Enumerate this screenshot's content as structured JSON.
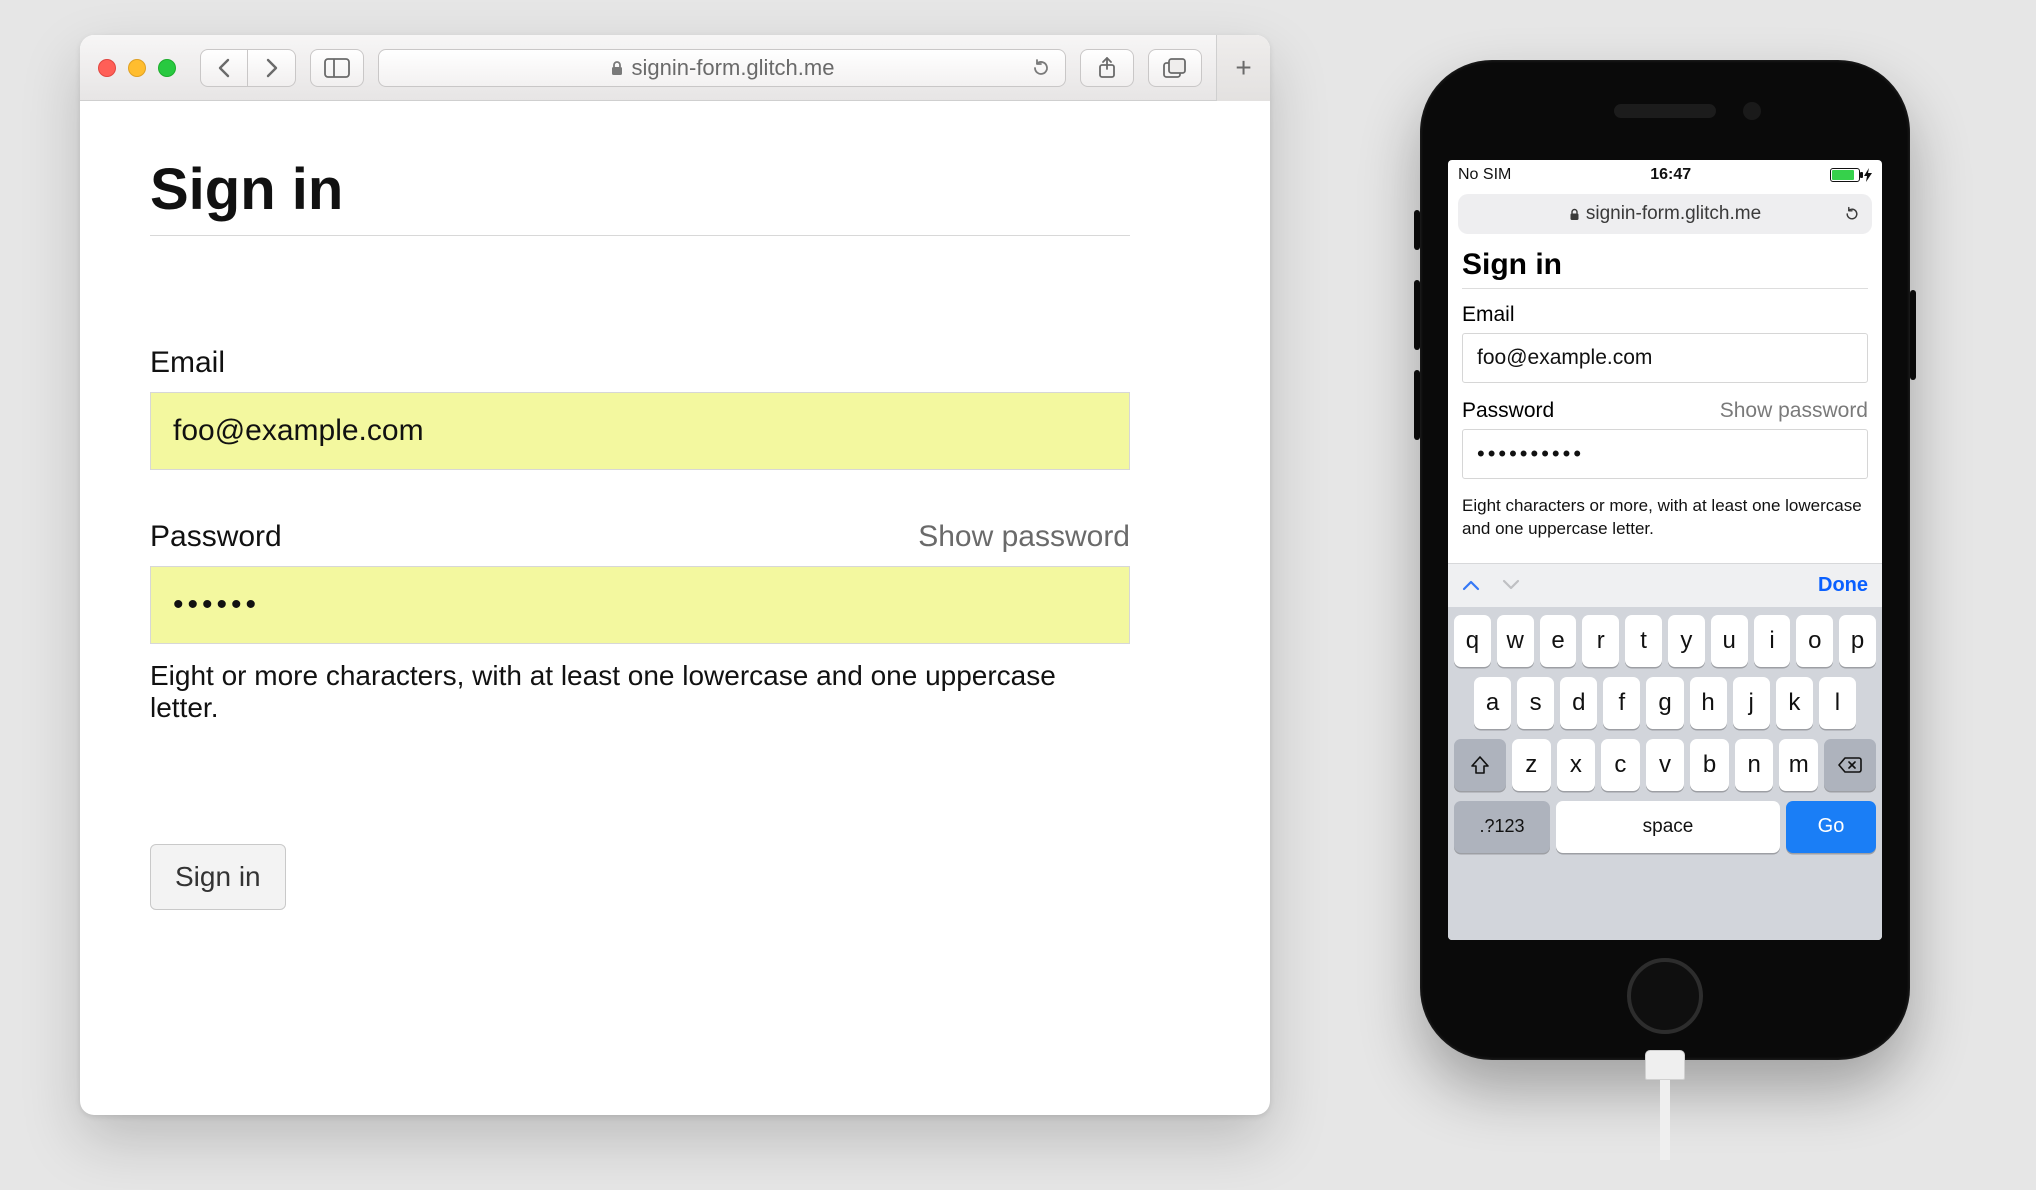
{
  "desktop": {
    "url_host": "signin-form.glitch.me",
    "page": {
      "title": "Sign in",
      "email_label": "Email",
      "email_value": "foo@example.com",
      "password_label": "Password",
      "show_password": "Show password",
      "password_mask": "••••••",
      "hint": "Eight or more characters, with at least one lowercase and one uppercase letter.",
      "submit": "Sign in"
    }
  },
  "mobile": {
    "status": {
      "carrier": "No SIM",
      "time": "16:47"
    },
    "url_host": "signin-form.glitch.me",
    "page": {
      "title": "Sign in",
      "email_label": "Email",
      "email_value": "foo@example.com",
      "password_label": "Password",
      "show_password": "Show password",
      "password_mask": "••••••••••",
      "hint": "Eight characters or more, with at least one lowercase and one uppercase letter."
    },
    "keyboard": {
      "done": "Done",
      "row1": [
        "q",
        "w",
        "e",
        "r",
        "t",
        "y",
        "u",
        "i",
        "o",
        "p"
      ],
      "row2": [
        "a",
        "s",
        "d",
        "f",
        "g",
        "h",
        "j",
        "k",
        "l"
      ],
      "row3": [
        "z",
        "x",
        "c",
        "v",
        "b",
        "n",
        "m"
      ],
      "numkey": ".?123",
      "space": "space",
      "go": "Go"
    }
  }
}
